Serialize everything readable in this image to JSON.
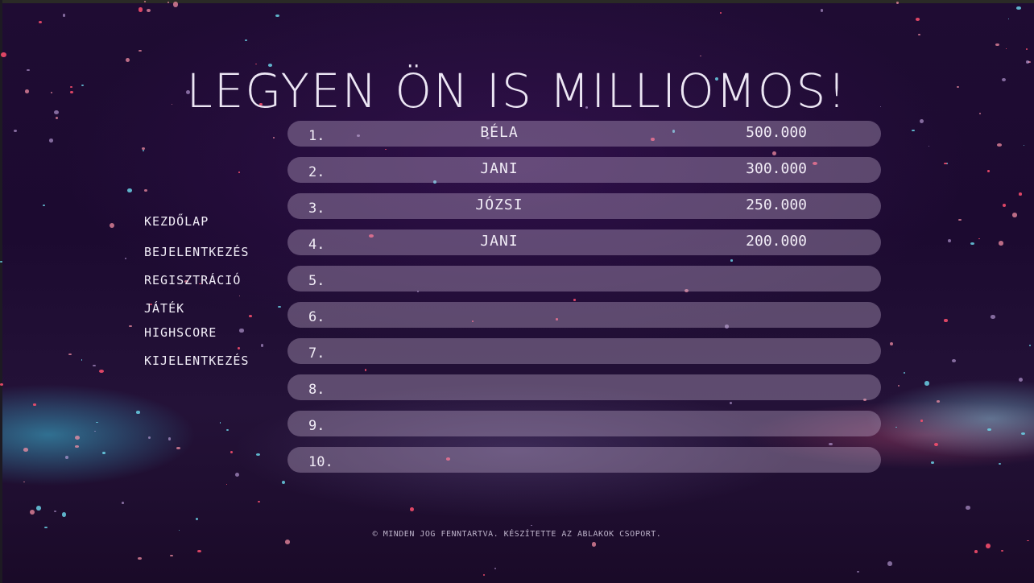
{
  "title": "Legyen ön is milliomos!",
  "nav": [
    {
      "label": "Kezdőlap"
    },
    {
      "label": "Bejelentkezés"
    },
    {
      "label": "Regisztráció"
    },
    {
      "label": "Játék"
    },
    {
      "label": "Highscore"
    },
    {
      "label": "Kijelentkezés"
    }
  ],
  "highscores": [
    {
      "rank": "1.",
      "name": "BÉLA",
      "score": "500.000"
    },
    {
      "rank": "2.",
      "name": "JANI",
      "score": "300.000"
    },
    {
      "rank": "3.",
      "name": "JÓZSI",
      "score": "250.000"
    },
    {
      "rank": "4.",
      "name": "JANI",
      "score": "200.000"
    },
    {
      "rank": "5.",
      "name": "",
      "score": ""
    },
    {
      "rank": "6.",
      "name": "",
      "score": ""
    },
    {
      "rank": "7.",
      "name": "",
      "score": ""
    },
    {
      "rank": "8.",
      "name": "",
      "score": ""
    },
    {
      "rank": "9.",
      "name": "",
      "score": ""
    },
    {
      "rank": "10.",
      "name": "",
      "score": ""
    }
  ],
  "footer": "© Minden jog fenntartva. Készítette az Ablakok csoport.",
  "colors": {
    "background": "#1f0c33",
    "row": "#c8b4d2",
    "text": "#f1ecf6"
  }
}
